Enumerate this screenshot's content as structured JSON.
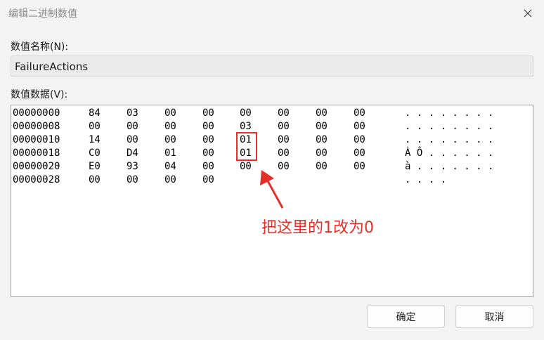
{
  "window": {
    "title": "编辑二进制数值"
  },
  "value_name": {
    "label": "数值名称(N):",
    "value": "FailureActions"
  },
  "value_data": {
    "label": "数值数据(V):",
    "rows": [
      {
        "addr": "00000000",
        "bytes": [
          "84",
          "03",
          "00",
          "00",
          "00",
          "00",
          "00",
          "00"
        ],
        "ascii": ". . . . . . . ."
      },
      {
        "addr": "00000008",
        "bytes": [
          "00",
          "00",
          "00",
          "00",
          "03",
          "00",
          "00",
          "00"
        ],
        "ascii": ". . . . . . . ."
      },
      {
        "addr": "00000010",
        "bytes": [
          "14",
          "00",
          "00",
          "00",
          "01",
          "00",
          "00",
          "00"
        ],
        "ascii": ". . . . . . . ."
      },
      {
        "addr": "00000018",
        "bytes": [
          "C0",
          "D4",
          "01",
          "00",
          "01",
          "00",
          "00",
          "00"
        ],
        "ascii": "À Ô . . . . . ."
      },
      {
        "addr": "00000020",
        "bytes": [
          "E0",
          "93",
          "04",
          "00",
          "00",
          "00",
          "00",
          "00"
        ],
        "ascii": "à . . . . . . ."
      },
      {
        "addr": "00000028",
        "bytes": [
          "00",
          "00",
          "00",
          "00"
        ],
        "ascii": ". . . ."
      }
    ]
  },
  "annotation": {
    "text": "把这里的1改为0",
    "color": "#e5302a"
  },
  "buttons": {
    "ok": "确定",
    "cancel": "取消"
  },
  "icons": {
    "close": "close-icon"
  }
}
